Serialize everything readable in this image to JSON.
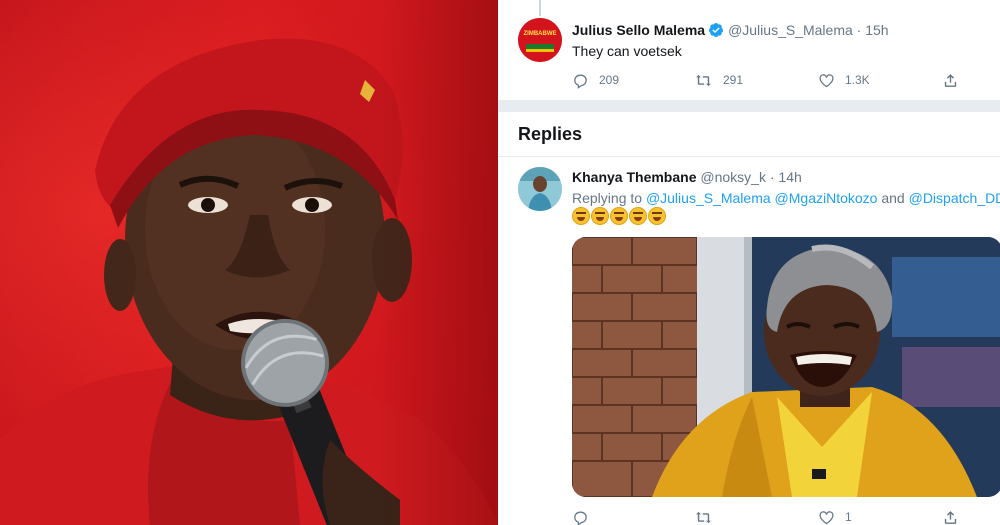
{
  "tweet": {
    "author_name": "Julius Sello Malema",
    "author_handle": "@Julius_S_Malema",
    "separator": "·",
    "time": "15h",
    "text": "They can voetsek",
    "avatar_text": "ZIMBABWE",
    "replies": "209",
    "retweets": "291",
    "likes": "1.3K"
  },
  "replies_section": {
    "title": "Replies"
  },
  "reply": {
    "author_name": "Khanya Thembane",
    "author_handle": "@noksy_k",
    "separator": "·",
    "time": "14h",
    "replying_prefix": "Replying to",
    "mention_1": "@Julius_S_Malema",
    "mention_2": "@MgaziNtokozo",
    "and_word": "and",
    "mention_3": "@Dispatch_DD",
    "emoji_count": 5,
    "replies": "",
    "retweets": "",
    "likes": "1"
  },
  "colors": {
    "accent": "#1da1f2",
    "secondary_text": "#657786",
    "separator": "#e6ecf0",
    "photo_red": "#d81b1f"
  },
  "icons": [
    "reply-icon",
    "retweet-icon",
    "like-icon",
    "share-icon",
    "verified-badge-icon"
  ]
}
